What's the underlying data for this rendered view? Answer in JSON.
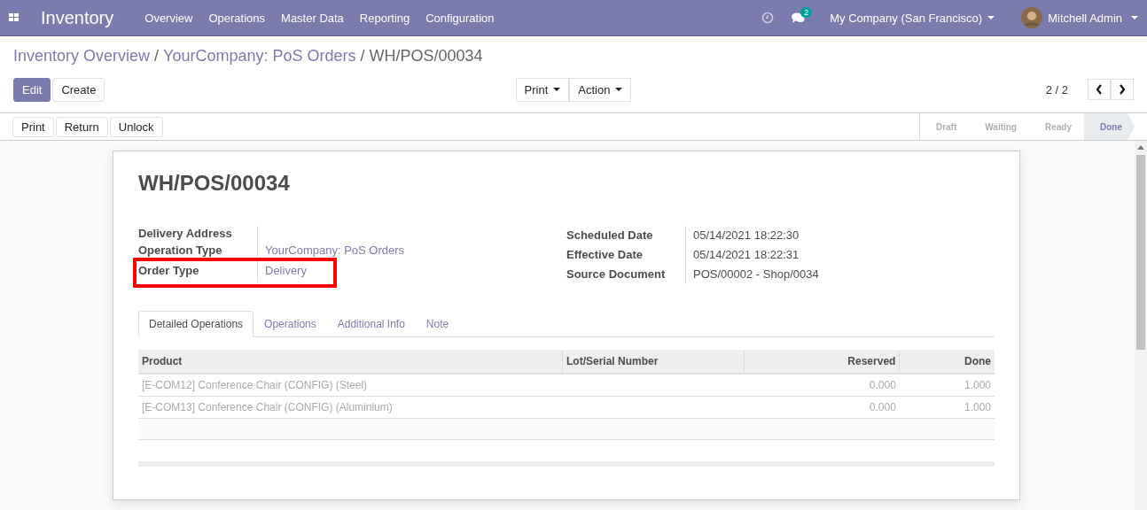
{
  "navbar": {
    "app_name": "Inventory",
    "menu": [
      "Overview",
      "Operations",
      "Master Data",
      "Reporting",
      "Configuration"
    ],
    "messages_count": "2",
    "company": "My Company (San Francisco)",
    "user": "Mitchell Admin"
  },
  "breadcrumbs": [
    {
      "label": "Inventory Overview",
      "kind": "link"
    },
    {
      "separator": "/",
      "label": "YourCompany: PoS Orders",
      "kind": "link"
    },
    {
      "separator": "/",
      "label": "WH/POS/00034",
      "kind": "current"
    }
  ],
  "buttons": {
    "primary": "Edit",
    "secondary": "Create"
  },
  "dropdowns": [
    "Print",
    "Action"
  ],
  "pager": "2 / 2",
  "action_buttons": [
    "Print",
    "Return",
    "Unlock"
  ],
  "stages": [
    {
      "label": "Draft",
      "selected": false
    },
    {
      "label": "Waiting",
      "selected": false
    },
    {
      "label": "Ready",
      "selected": false
    },
    {
      "label": "Done",
      "selected": true
    }
  ],
  "record": {
    "title": "WH/POS/00034",
    "left_fields": [
      {
        "label": "Delivery Address"
      },
      {
        "label": "Operation Type",
        "value": "YourCompany: PoS Orders"
      },
      {
        "label": "Order Type",
        "value": "Delivery",
        "highlighted": true
      }
    ],
    "right_fields": [
      {
        "label": "Scheduled Date",
        "value": "05/14/2021 18:22:30"
      },
      {
        "label": "Effective Date",
        "value": "05/14/2021 18:22:31"
      },
      {
        "label": "Source Document",
        "value": "POS/00002 - Shop/0034"
      }
    ],
    "tabs": [
      {
        "label": "Detailed Operations",
        "selected": true
      },
      {
        "label": "Operations",
        "selected": false
      },
      {
        "label": "Additional Info",
        "selected": false
      },
      {
        "label": "Note",
        "selected": false
      }
    ],
    "table": {
      "columns": [
        "Product",
        "Lot/Serial Number",
        "Reserved",
        "Done"
      ],
      "rows": [
        {
          "product": "[E-COM12] Conference Chair (CONFIG) (Steel)",
          "reserved": "0.000",
          "done": "1.000"
        },
        {
          "product": "[E-COM13] Conference Chair (CONFIG) (Aluminium)",
          "reserved": "0.000",
          "done": "1.000"
        }
      ]
    }
  }
}
